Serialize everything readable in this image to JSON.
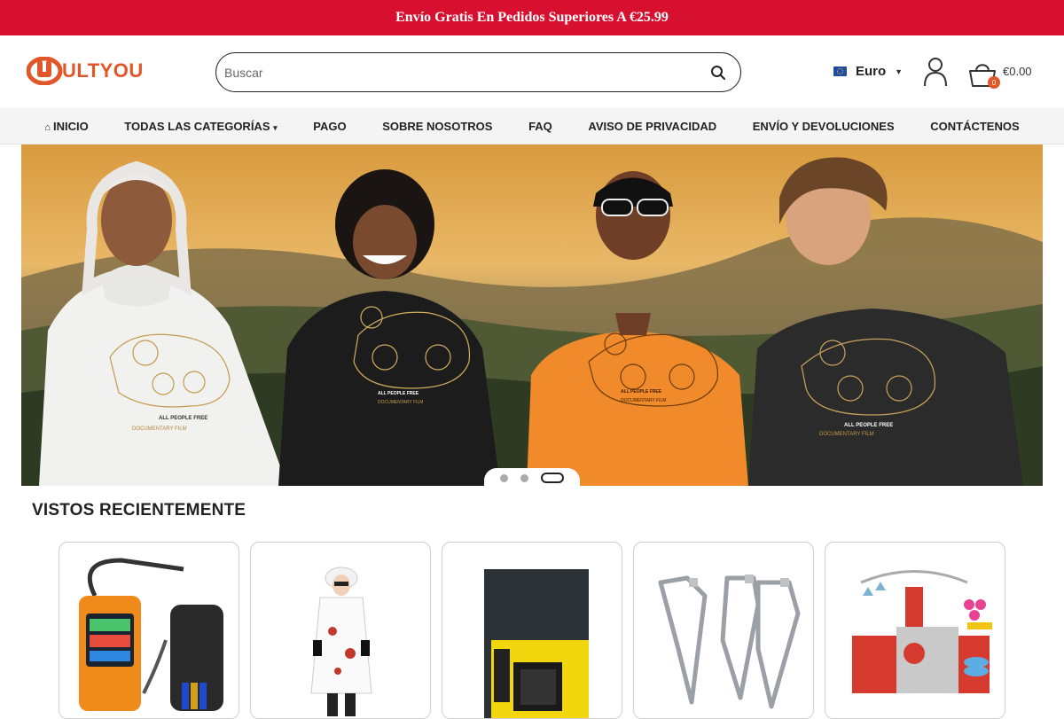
{
  "promo": {
    "text": "Envío Gratis En Pedidos Superiores A €25.99"
  },
  "logo": {
    "text": "ULTYOU"
  },
  "search": {
    "placeholder": "Buscar"
  },
  "currency": {
    "label": "Euro"
  },
  "cart": {
    "count": "0",
    "total": "€0.00"
  },
  "nav": {
    "items": [
      {
        "label": "INICIO",
        "icon": "home-icon"
      },
      {
        "label": "TODAS LAS CATEGORÍAS",
        "icon": "chevron-down-icon"
      },
      {
        "label": "PAGO"
      },
      {
        "label": "SOBRE NOSOTROS"
      },
      {
        "label": "FAQ"
      },
      {
        "label": "AVISO DE PRIVACIDAD"
      },
      {
        "label": "ENVÍO Y DEVOLUCIONES"
      },
      {
        "label": "CONTÁCTENOS"
      }
    ]
  },
  "hero": {
    "slides": 3,
    "active_slide": 3,
    "shirt_print_line1": "ALL PEOPLE FREE",
    "shirt_print_line2": "DOCUMENTARY FILM"
  },
  "recently_viewed": {
    "title": "VISTOS RECIENTEMENTE",
    "products": [
      {
        "image": "gas-leak-detector-image"
      },
      {
        "image": "mad-scientist-costume-image"
      },
      {
        "image": "black-document-folder-image"
      },
      {
        "image": "metal-bracket-set-image"
      },
      {
        "image": "toy-kitchen-playset-image"
      }
    ]
  },
  "colors": {
    "accent": "#d8102f",
    "brand": "#e2572a",
    "nav_bg": "#f4f4f4"
  }
}
